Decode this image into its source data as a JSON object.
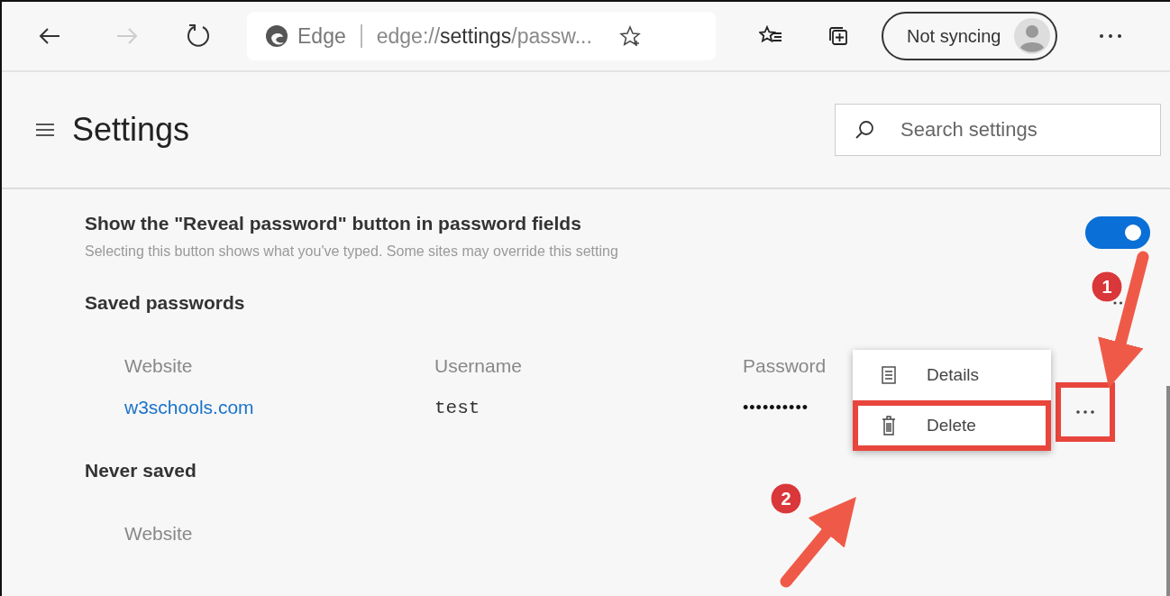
{
  "toolbar": {
    "site_label": "Edge",
    "address": "edge://**settings**/passw...",
    "sync_label": "Not syncing"
  },
  "header": {
    "title": "Settings",
    "search": {
      "placeholder": "Search settings"
    }
  },
  "reveal_setting": {
    "title": "Show the \"Reveal password\" button in password fields",
    "description": "Selecting this button shows what you've typed. Some sites may override this setting",
    "on": true
  },
  "saved_passwords": {
    "title": "Saved passwords",
    "columns": [
      "Website",
      "Username",
      "Password"
    ],
    "rows": [
      {
        "website": "w3schools.com",
        "username": "test",
        "password": "••••••••••",
        "more_highlighted": true
      }
    ]
  },
  "menu": [
    {
      "label": "Details",
      "kind": "details",
      "highlighted": false
    },
    {
      "label": "Delete",
      "kind": "delete",
      "highlighted": true
    }
  ],
  "never_saved": {
    "title": "Never saved",
    "columns": [
      "Website"
    ]
  },
  "annotations": [
    {
      "label": "1"
    },
    {
      "label": "2"
    }
  ]
}
